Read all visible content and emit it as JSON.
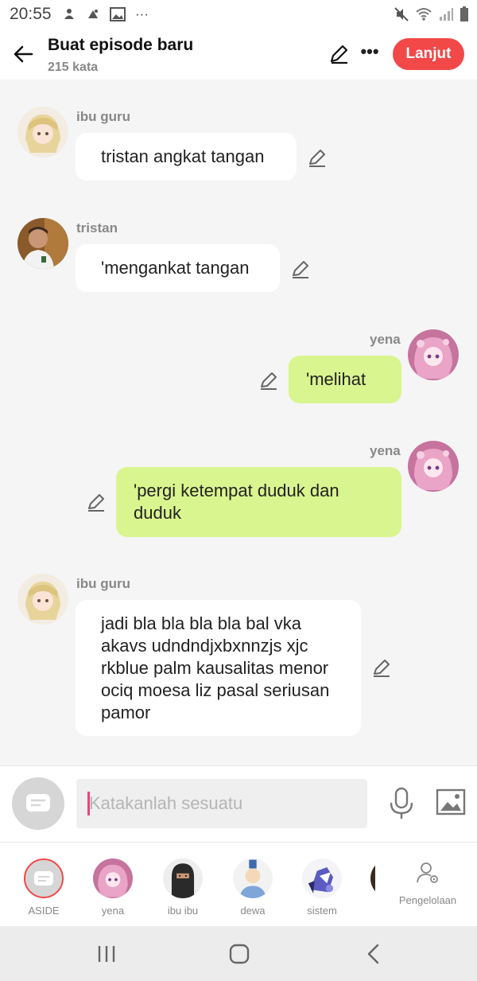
{
  "status_bar": {
    "time": "20:55",
    "left_icons": [
      "notification-icon",
      "notification-icon",
      "image-icon",
      "more-icon"
    ],
    "right_icons": [
      "mute-icon",
      "wifi-icon",
      "signal-icon",
      "battery-icon"
    ]
  },
  "header": {
    "title": "Buat episode baru",
    "word_count": "215 kata",
    "next_label": "Lanjut",
    "accent_color": "#f24848"
  },
  "messages": [
    {
      "speaker": "ibu guru",
      "side": "left",
      "text": "tristan angkat tangan",
      "avatar": "anime-girl-blonde"
    },
    {
      "speaker": "tristan",
      "side": "left",
      "text": "'mengankat tangan",
      "avatar": "boy-photo"
    },
    {
      "speaker": "yena",
      "side": "right",
      "text": "'melihat",
      "avatar": "anime-girl-pink"
    },
    {
      "speaker": "yena",
      "side": "right",
      "text": "'pergi ketempat duduk dan duduk",
      "avatar": "anime-girl-pink"
    },
    {
      "speaker": "ibu guru",
      "side": "left",
      "text": "jadi bla bla bla bla bal vka akavs udndndjxbxnnzjs xjc rkblue palm kausalitas menor ociq moesa liz pasal seriusan pamor",
      "avatar": "anime-girl-blonde"
    }
  ],
  "input": {
    "placeholder": "Katakanlah sesuatu"
  },
  "characters": [
    {
      "label": "ASIDE"
    },
    {
      "label": "yena"
    },
    {
      "label": "ibu ibu"
    },
    {
      "label": "dewa"
    },
    {
      "label": "sistem"
    }
  ],
  "manage_label": "Pengelolaan",
  "colors": {
    "bubble_right": "#d9f58f",
    "bubble_left": "#ffffff",
    "background": "#f5f5f5"
  }
}
